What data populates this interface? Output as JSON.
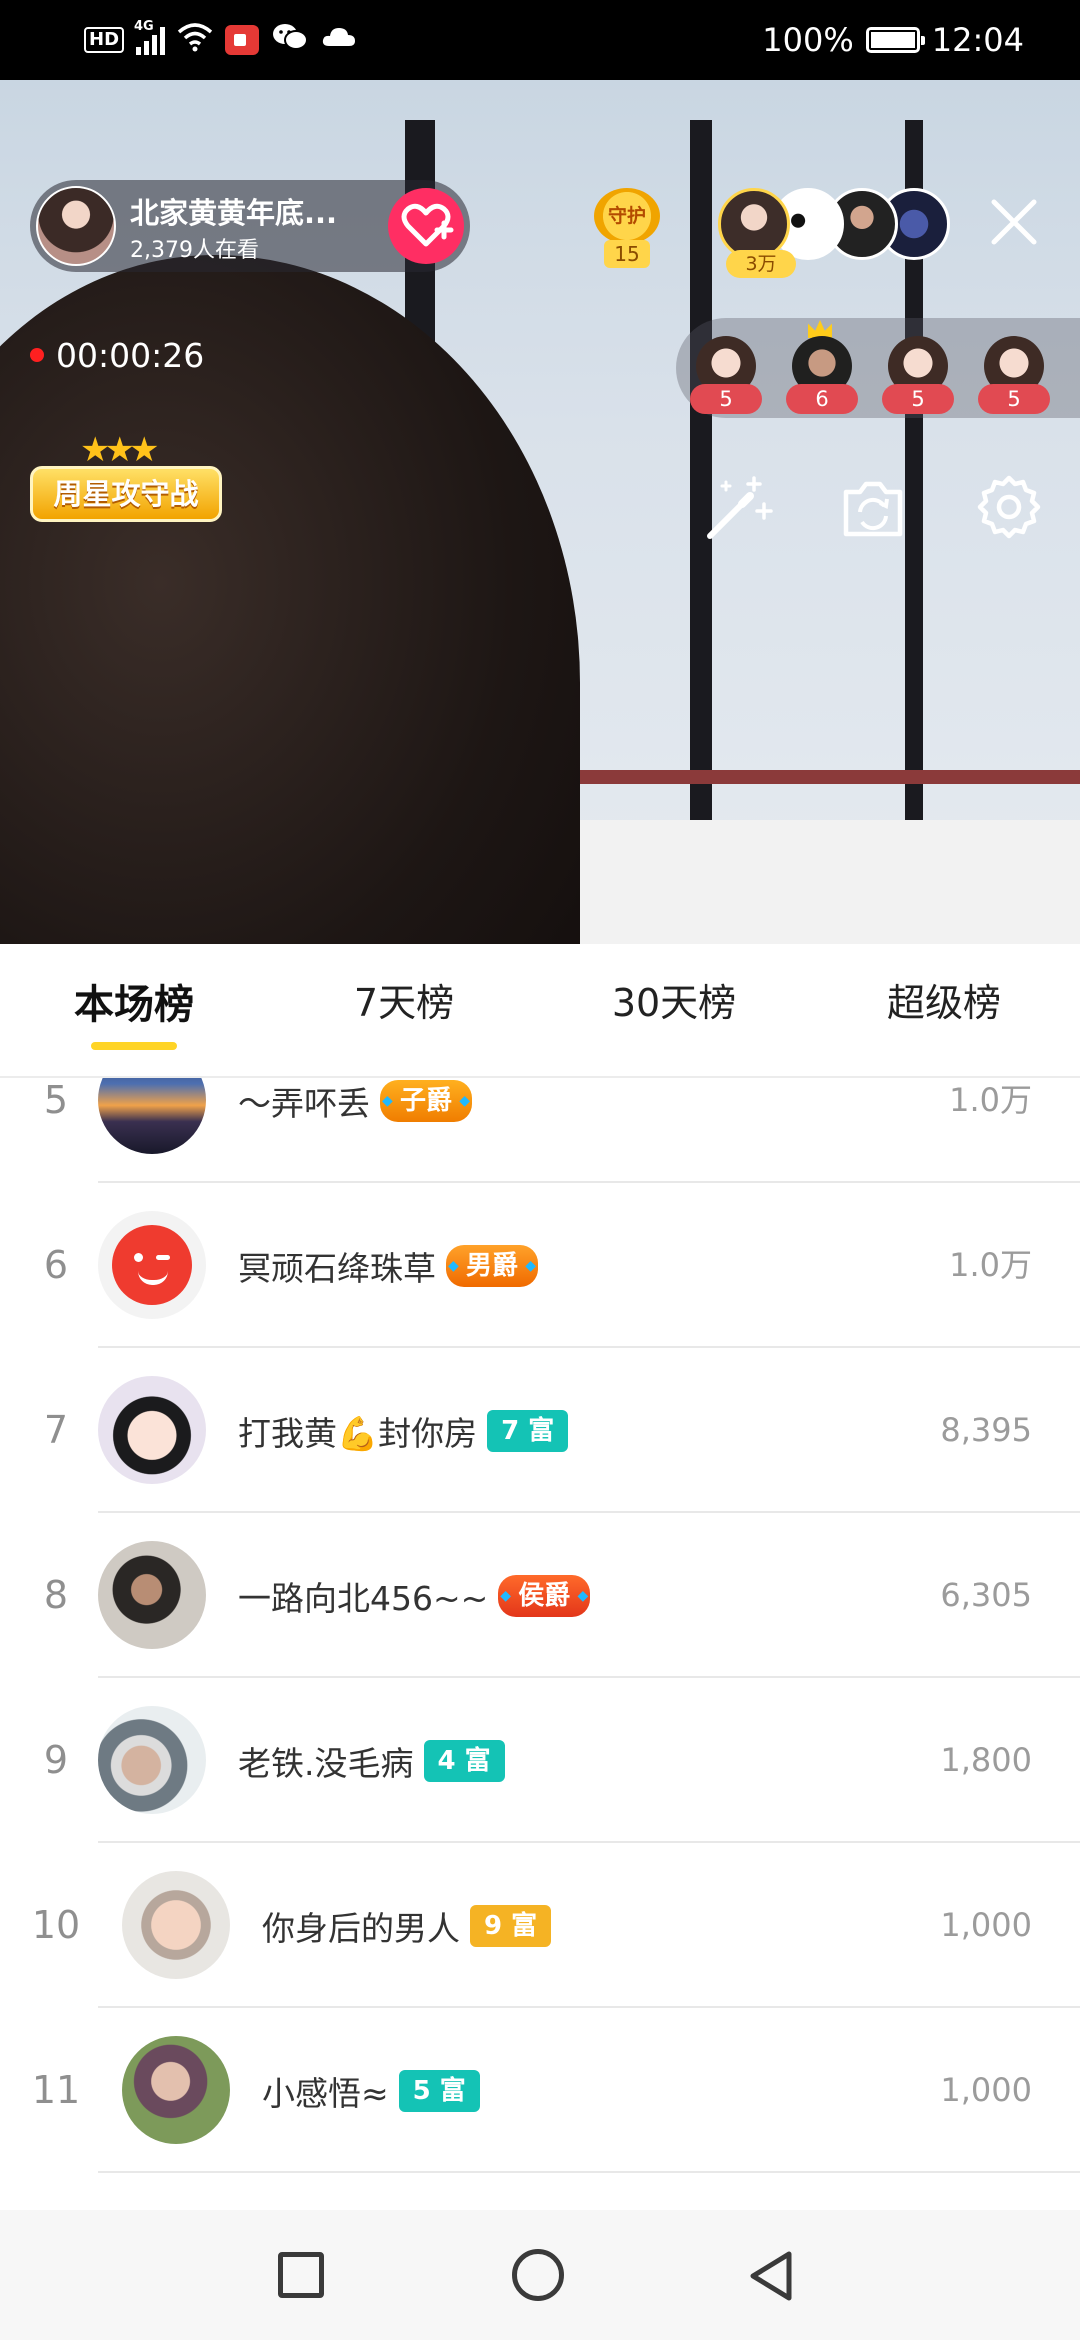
{
  "status_bar": {
    "hd": "HD",
    "network": "4G",
    "battery": "100%",
    "time": "12:04",
    "icons": [
      "hd-icon",
      "signal-icon",
      "wifi-icon",
      "screen-record-icon",
      "wechat-icon",
      "cloud-icon",
      "battery-icon"
    ]
  },
  "live": {
    "host_name": "北家黄黄年底...",
    "viewers": "2,379人在看",
    "guard_label": "守护",
    "guard_count": "15",
    "top_audience_badge": "3万",
    "elapsed": "00:00:26",
    "pk_counts": [
      "5",
      "6",
      "5",
      "5"
    ],
    "weekly_star": "周星攻守战"
  },
  "tabs": [
    {
      "label": "本场榜",
      "active": true
    },
    {
      "label": "7天榜",
      "active": false
    },
    {
      "label": "30天榜",
      "active": false
    },
    {
      "label": "超级榜",
      "active": false
    }
  ],
  "ranking": [
    {
      "rank": "5",
      "name": "～弄吥丢",
      "badge": "子爵",
      "badge_style": "noble-zijue",
      "score": "1.0万"
    },
    {
      "rank": "6",
      "name": "冥顽石绛珠草",
      "badge": "男爵",
      "badge_style": "noble-nanjue",
      "score": "1.0万"
    },
    {
      "rank": "7",
      "name": "打我黄💪封你房",
      "badge": "7 富",
      "badge_style": "rich-teal",
      "score": "8,395"
    },
    {
      "rank": "8",
      "name": "一路向北456~~",
      "badge": "侯爵",
      "badge_style": "noble-houjue",
      "score": "6,305"
    },
    {
      "rank": "9",
      "name": "老铁.没毛病",
      "badge": "4 富",
      "badge_style": "rich-teal",
      "score": "1,800"
    },
    {
      "rank": "10",
      "name": "你身后的男人",
      "badge": "9 富",
      "badge_style": "rich-gold",
      "score": "1,000"
    },
    {
      "rank": "11",
      "name": "小感悟≈",
      "badge": "5 富",
      "badge_style": "rich-teal",
      "score": "1,000"
    }
  ],
  "colors": {
    "accent_yellow": "#ffd426",
    "follow_pink": "#ff2e63",
    "rich_teal": "#14c3b5",
    "rich_gold": "#f5b324",
    "live_red": "#ff2020"
  }
}
